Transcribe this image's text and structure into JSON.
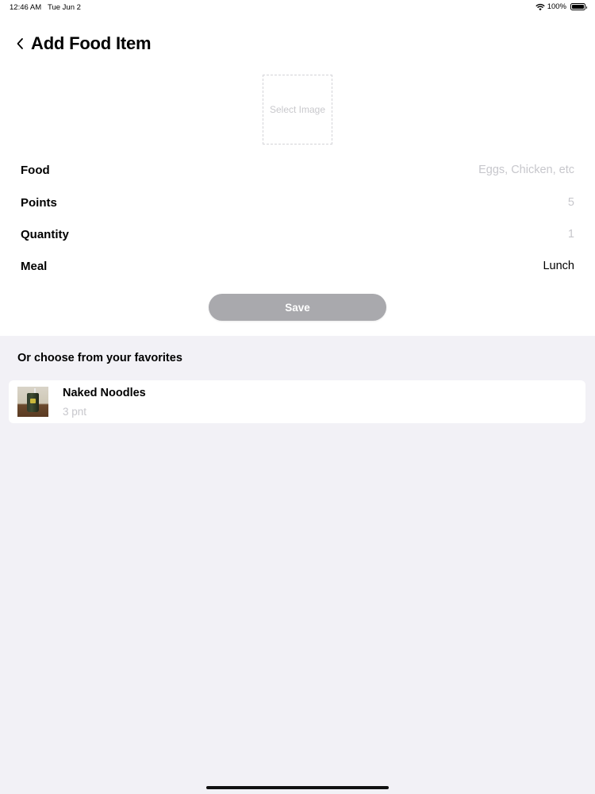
{
  "status_bar": {
    "time": "12:46 AM",
    "date": "Tue Jun 2",
    "battery": "100%",
    "battery_level": 1.0
  },
  "header": {
    "back_icon": "chevron-left-icon",
    "title": "Add Food Item"
  },
  "image_picker": {
    "label": "Select Image"
  },
  "form": {
    "food": {
      "label": "Food",
      "value": "",
      "placeholder": "Eggs, Chicken, etc"
    },
    "points": {
      "label": "Points",
      "value": "",
      "placeholder": "5"
    },
    "quantity": {
      "label": "Quantity",
      "value": "",
      "placeholder": "1"
    },
    "meal": {
      "label": "Meal",
      "value": "Lunch"
    }
  },
  "save_button": {
    "label": "Save"
  },
  "favorites": {
    "title": "Or choose from your favorites",
    "items": [
      {
        "name": "Naked Noodles",
        "points": "3 pnt"
      }
    ]
  },
  "colors": {
    "background": "#f2f1f6",
    "panel": "#ffffff",
    "save_button": "#a9a9ad",
    "placeholder": "#c7c7cc"
  }
}
